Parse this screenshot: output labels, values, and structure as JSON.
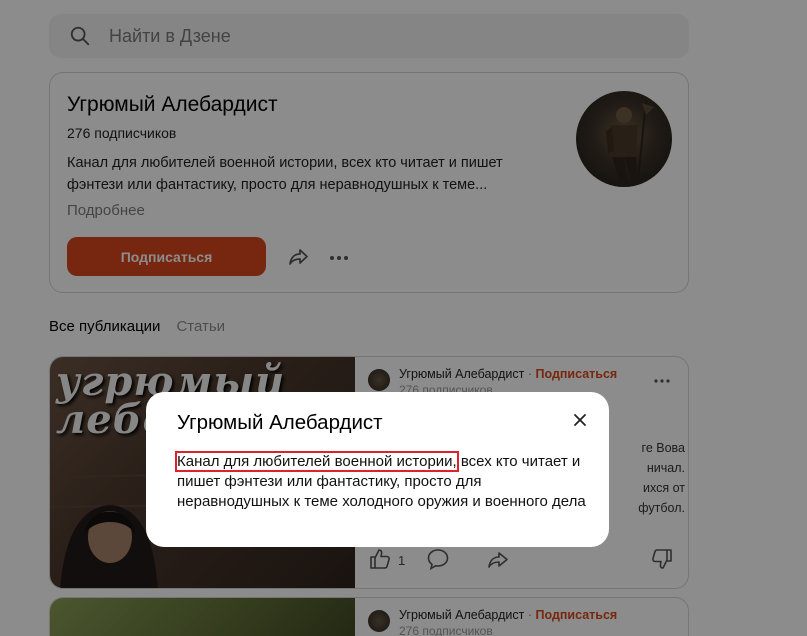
{
  "search": {
    "placeholder": "Найти в Дзене"
  },
  "channel": {
    "name": "Угрюмый Алебардист",
    "subscribers": "276 подписчиков",
    "description": "Канал для любителей военной истории, всех кто читает и пишет фэнтези или фантастику, просто для неравнодушных к теме...",
    "more_label": "Подробнее",
    "subscribe_label": "Подписаться"
  },
  "tabs": [
    {
      "label": "Все публикации",
      "active": true
    },
    {
      "label": "Статьи",
      "active": false
    }
  ],
  "cards": [
    {
      "thumb_text_line1": "угрюмый",
      "thumb_text_line2": "лебо",
      "author": "Угрюмый Алебардист",
      "separator": "·",
      "subscribe_label": "Подписаться",
      "subscribers": "276 подписчиков",
      "visible_fragments": [
        "ге Вова",
        "ничал.",
        "ихся от",
        "футбол."
      ],
      "likes": "1"
    },
    {
      "author": "Угрюмый Алебардист",
      "separator": "·",
      "subscribe_label": "Подписаться",
      "subscribers": "276 подписчиков"
    }
  ],
  "modal": {
    "title": "Угрюмый Алебардист",
    "text_highlighted": "Канал для любителей военной истории,",
    "text_rest": " всех кто читает и пишет фэнтези или фантастику, просто для неравнодушных к теме холодного оружия и военного дела"
  },
  "colors": {
    "accent": "#d9481c",
    "overlay": "rgba(0,0,0,0.45)",
    "highlight_box": "#e0202a"
  }
}
